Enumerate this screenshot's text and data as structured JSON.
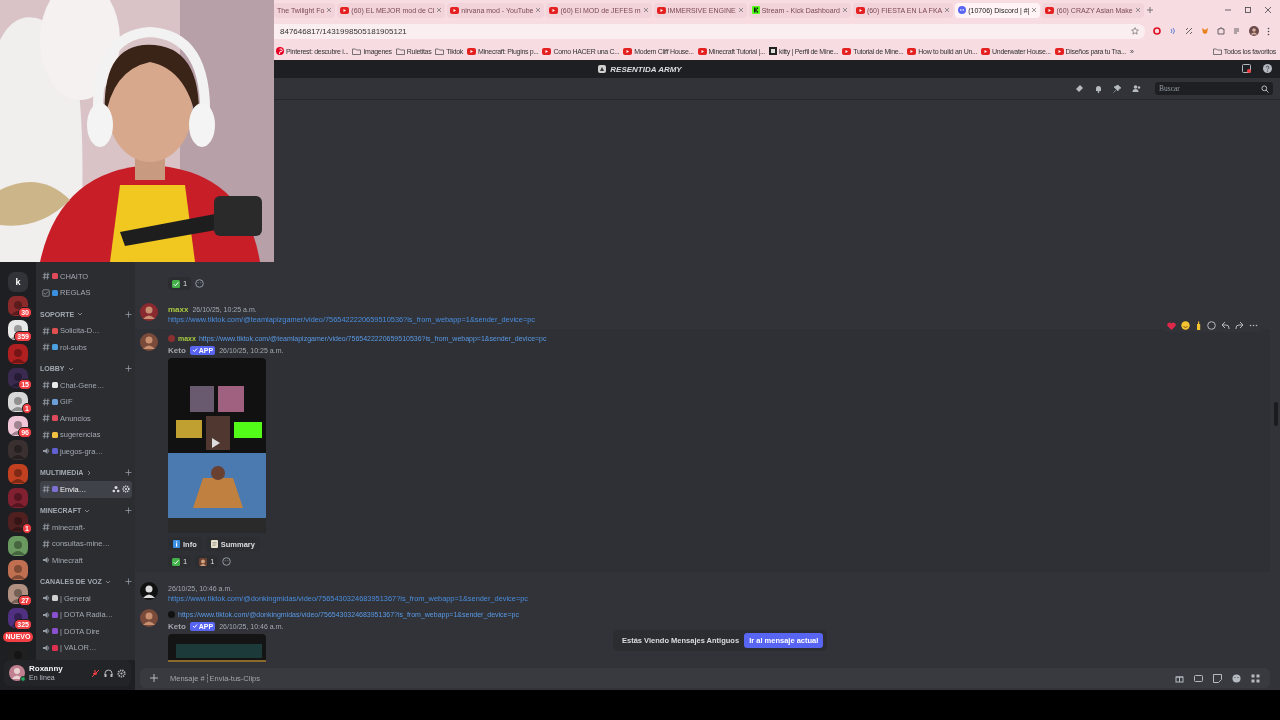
{
  "browser": {
    "tabs": [
      {
        "title": "The Twilight Fo",
        "kind": "page",
        "selected": false
      },
      {
        "title": "(60) EL MEJOR mod de Cl",
        "kind": "youtube",
        "selected": false
      },
      {
        "title": "nirvana mod - YouTube",
        "kind": "youtube",
        "selected": false
      },
      {
        "title": "(60) El MOD de JEFES m",
        "kind": "youtube",
        "selected": false
      },
      {
        "title": "IMMERSIVE ENGINE",
        "kind": "youtube",
        "selected": false
      },
      {
        "title": "Stream - Kick Dashboard",
        "kind": "kick",
        "selected": false
      },
      {
        "title": "(60) FIESTA EN LA FKA",
        "kind": "youtube",
        "selected": false
      },
      {
        "title": "(10706) Discord | #|",
        "kind": "discord",
        "selected": true
      },
      {
        "title": "(60) CRAZY Asian Make",
        "kind": "youtube",
        "selected": false
      }
    ],
    "address": "847646817/1431998505181905121",
    "bookmarks": [
      {
        "label": "Pinterest: descubre i...",
        "kind": "pinterest"
      },
      {
        "label": "Imagenes",
        "kind": "folder"
      },
      {
        "label": "Ruletitas",
        "kind": "folder"
      },
      {
        "label": "Tiktok",
        "kind": "folder"
      },
      {
        "label": "Minecraft: Plugins p...",
        "kind": "youtube"
      },
      {
        "label": "Como HACER una C...",
        "kind": "youtube"
      },
      {
        "label": "Modern Cliff House...",
        "kind": "youtube"
      },
      {
        "label": "Minecraft Tutorial |...",
        "kind": "youtube"
      },
      {
        "label": "kitty | Perfil de Mine...",
        "kind": "site"
      },
      {
        "label": "Tutorial de Mine...",
        "kind": "youtube"
      },
      {
        "label": "How to build an Un...",
        "kind": "youtube"
      },
      {
        "label": "Underwater House...",
        "kind": "youtube"
      },
      {
        "label": "Diseños para tu Tra...",
        "kind": "youtube"
      }
    ],
    "more_bookmarks": "»",
    "all_bookmarks": "Todos los favoritos"
  },
  "webcam": {
    "kind": "picture"
  },
  "server": {
    "name": "RESENTIDA ARMY"
  },
  "search": {
    "placeholder": "Buscar"
  },
  "servers": [
    {
      "kind": "letter",
      "letter": "k"
    },
    {
      "kind": "picture",
      "color": "#8a2a2a",
      "badge": "30"
    },
    {
      "kind": "picture",
      "color": "#e8e8e8",
      "badge": "359"
    },
    {
      "kind": "picture",
      "color": "#b02020"
    },
    {
      "kind": "picture",
      "color": "#3a2a50",
      "badge": "15"
    },
    {
      "kind": "picture",
      "color": "#d8d8d8",
      "badge": "1"
    },
    {
      "kind": "picture",
      "color": "#f0c8d8",
      "badge": "96"
    },
    {
      "kind": "picture",
      "color": "#3a3030"
    },
    {
      "kind": "picture",
      "color": "#c04020"
    },
    {
      "kind": "picture",
      "color": "#802030"
    },
    {
      "kind": "picture",
      "color": "#502020",
      "badge": "1"
    },
    {
      "kind": "picture",
      "color": "#6a9a60"
    },
    {
      "kind": "picture",
      "color": "#c07050"
    },
    {
      "kind": "picture",
      "color": "#b09080",
      "badge": "27"
    },
    {
      "kind": "picture",
      "color": "#503080",
      "badge": "325"
    },
    {
      "kind": "picture",
      "color": "#202020"
    }
  ],
  "new_badge": "NUEVO",
  "channels": [
    {
      "kind": "text",
      "name": "CHAITO",
      "color": "#e04a5a",
      "selected": false
    },
    {
      "kind": "rules",
      "name": "REGLAS",
      "color": "#3b8fe0",
      "selected": false
    },
    {
      "kind": "category",
      "name": "SOPORTE",
      "expanded": true
    },
    {
      "kind": "text",
      "name": "Solicita-D…",
      "color": "#e05050",
      "selected": false
    },
    {
      "kind": "text",
      "name": "rol-subs",
      "color": "#4aa0e0",
      "selected": false
    },
    {
      "kind": "category",
      "name": "LOBBY",
      "expanded": true
    },
    {
      "kind": "text",
      "name": "Chat-Gene…",
      "color": "#e8e8e8",
      "selected": false
    },
    {
      "kind": "text",
      "name": "GIF",
      "color": "#6a9fd8",
      "selected": false
    },
    {
      "kind": "text",
      "name": "Anuncios",
      "color": "#e04a5a",
      "selected": false
    },
    {
      "kind": "text",
      "name": "sugerencias",
      "color": "#f0c040",
      "selected": false
    },
    {
      "kind": "voice",
      "name": "juegos-gra…",
      "color": "#6060d0",
      "selected": false
    },
    {
      "kind": "category",
      "name": "MULTIMEDIA",
      "expanded": false
    },
    {
      "kind": "text",
      "name": "Envia…",
      "color": "#7b6fd0",
      "selected": true
    },
    {
      "kind": "category",
      "name": "MINECRAFT",
      "expanded": true
    },
    {
      "kind": "text",
      "name": "minecraft-",
      "selected": false
    },
    {
      "kind": "text",
      "name": "consultas-mine…",
      "selected": false
    },
    {
      "kind": "voice",
      "name": "Minecraft",
      "selected": false
    },
    {
      "kind": "category",
      "name": "CANALES DE VOZ",
      "expanded": true
    },
    {
      "kind": "voice",
      "name": "| General",
      "color": "#d0d0d0",
      "selected": false
    },
    {
      "kind": "voice",
      "name": "| DOTA Radia…",
      "color": "#8a50d0",
      "selected": false
    },
    {
      "kind": "voice",
      "name": "| DOTA Dire",
      "color": "#8a50d0",
      "selected": false
    },
    {
      "kind": "voice",
      "name": "| VALOR…",
      "color": "#e03050",
      "selected": false
    }
  ],
  "user": {
    "name": "Roxanny",
    "status": "En línea",
    "muted": true
  },
  "messages": [
    {
      "highlighted": false,
      "reactions": [
        {
          "kind": "check",
          "count": "1"
        }
      ]
    },
    {
      "highlighted": false,
      "author": "maxx",
      "timestamp": "26/10/25, 10:25 a.m.",
      "link": "https://www.tiktok.com/@teamlapizgamer/video/7565422220659510536?is_from_webapp=1&sender_device=pc"
    },
    {
      "highlighted": true,
      "reply": {
        "author": "maxx",
        "link": "https://www.tiktok.com/@teamlapizgamer/video/7565422220659510536?is_from_webapp=1&sender_device=pc"
      },
      "author": "Keto",
      "app_tag": "APP",
      "timestamp": "26/10/25, 10:25 a.m.",
      "embed": {
        "kind": "picture"
      },
      "buttons": [
        "Info",
        "Summary"
      ],
      "reactions": [
        {
          "kind": "check",
          "count": "1"
        },
        {
          "kind": "avatar",
          "count": "1"
        }
      ]
    },
    {
      "highlighted": false,
      "timestamp": "26/10/25, 10:46 a.m.",
      "link": "https://www.tiktok.com/@donkingmidas/video/7565430324683951367?is_from_webapp=1&sender_device=pc"
    },
    {
      "highlighted": false,
      "reply": {
        "link": "https://www.tiktok.com/@donkingmidas/video/7565430324683951367?is_from_webapp=1&sender_device=pc"
      },
      "author": "Keto",
      "app_tag": "APP",
      "timestamp": "26/10/25, 10:46 a.m.",
      "embed": {
        "kind": "picture"
      }
    }
  ],
  "old_messages": {
    "text": "Estás Viendo Mensajes Antiguos",
    "button": "Ir al mensaje actual"
  },
  "composer": {
    "placeholder": "Mensaje #┆Envia-tus-Clips"
  }
}
